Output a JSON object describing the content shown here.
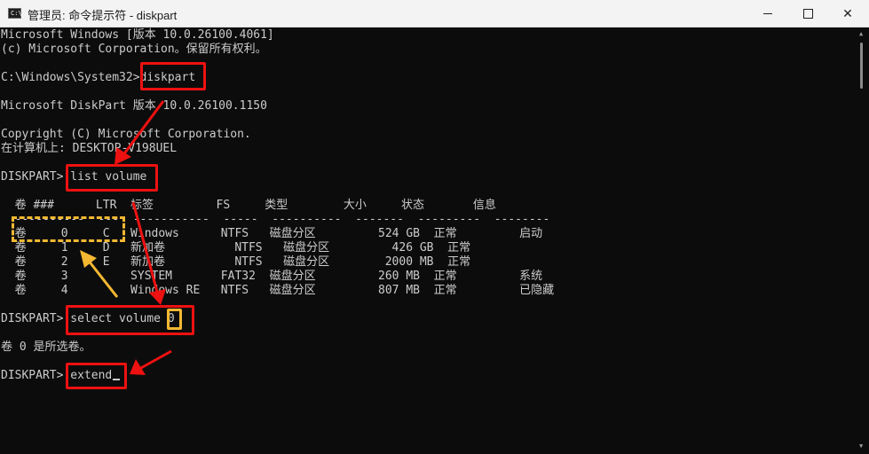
{
  "window": {
    "title": "管理员: 命令提示符 - diskpart",
    "icon_label": "C:\\",
    "buttons": {
      "minimize": "minimize-icon",
      "maximize": "maximize-icon",
      "close": "✕"
    }
  },
  "console": {
    "lines": [
      "Microsoft Windows [版本 10.0.26100.4061]",
      "(c) Microsoft Corporation。保留所有权利。",
      "C:\\Windows\\System32>diskpart",
      "Microsoft DiskPart 版本 10.0.26100.1150",
      "Copyright (C) Microsoft Corporation.",
      "在计算机上: DESKTOP-V198UEL",
      "DISKPART> list volume",
      "  卷 ###      LTR  标签         FS     类型        大小     状态       信息",
      "  ----------  ---  -----------  -----  ----------  -------  ---------  --------",
      "  卷     0     C   Windows      NTFS   磁盘分区         524 GB  正常         启动",
      "  卷     1     D   新加卷          NTFS   磁盘分区         426 GB  正常",
      "  卷     2     E   新加卷          NTFS   磁盘分区        2000 MB  正常",
      "  卷     3         SYSTEM       FAT32  磁盘分区         260 MB  正常         系统",
      "  卷     4         Windows RE   NTFS   磁盘分区         807 MB  正常         已隐藏",
      "DISKPART> select volume 0",
      "卷 0 是所选卷。",
      "DISKPART> extend"
    ]
  },
  "annotation_colors": {
    "box": "#ee1111",
    "highlight": "#f3b832"
  }
}
